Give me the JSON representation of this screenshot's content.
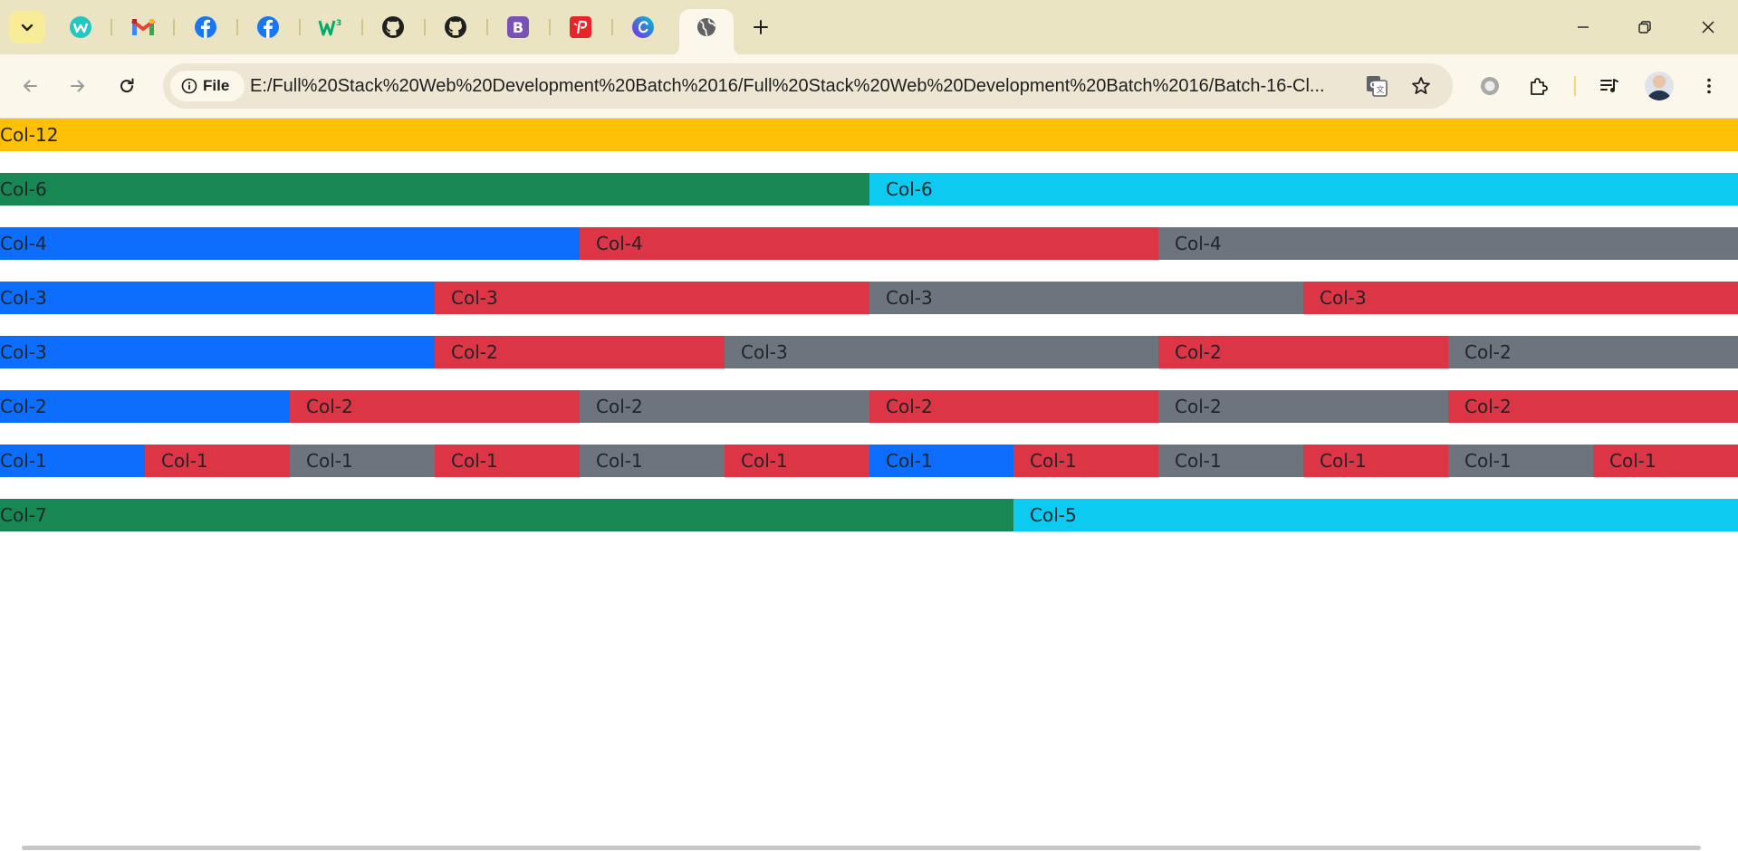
{
  "browser": {
    "tabs": [
      {
        "icon": "wix-icon"
      },
      {
        "icon": "gmail-icon"
      },
      {
        "icon": "facebook-icon"
      },
      {
        "icon": "facebook-icon"
      },
      {
        "icon": "w3schools-icon"
      },
      {
        "icon": "github-icon"
      },
      {
        "icon": "github-icon"
      },
      {
        "icon": "bootstrap-icon"
      },
      {
        "icon": "pdf-icon"
      },
      {
        "icon": "canva-icon"
      },
      {
        "icon": "globe-icon",
        "active": true
      }
    ],
    "site_chip_label": "File",
    "url": "E:/Full%20Stack%20Web%20Development%20Batch%2016/Full%20Stack%20Web%20Development%20Batch%2016/Batch-16-Cl...",
    "colors": {
      "tabstrip": "#ebe4c2",
      "toolbar": "#fbf7ea",
      "omnibox": "#ede6d3",
      "tab_search": "#f8ec98"
    }
  },
  "grid_rows": [
    [
      {
        "label": "Col-12",
        "span": 12,
        "color": "#ffc107"
      }
    ],
    [
      {
        "label": "Col-6",
        "span": 6,
        "color": "#198754"
      },
      {
        "label": "Col-6",
        "span": 6,
        "color": "#0dcaf0"
      }
    ],
    [
      {
        "label": "Col-4",
        "span": 4,
        "color": "#0d6efd"
      },
      {
        "label": "Col-4",
        "span": 4,
        "color": "#dc3545"
      },
      {
        "label": "Col-4",
        "span": 4,
        "color": "#6c757d"
      }
    ],
    [
      {
        "label": "Col-3",
        "span": 3,
        "color": "#0d6efd"
      },
      {
        "label": "Col-3",
        "span": 3,
        "color": "#dc3545"
      },
      {
        "label": "Col-3",
        "span": 3,
        "color": "#6c757d"
      },
      {
        "label": "Col-3",
        "span": 3,
        "color": "#dc3545"
      }
    ],
    [
      {
        "label": "Col-3",
        "span": 3,
        "color": "#0d6efd"
      },
      {
        "label": "Col-2",
        "span": 2,
        "color": "#dc3545"
      },
      {
        "label": "Col-3",
        "span": 3,
        "color": "#6c757d"
      },
      {
        "label": "Col-2",
        "span": 2,
        "color": "#dc3545"
      },
      {
        "label": "Col-2",
        "span": 2,
        "color": "#6c757d"
      }
    ],
    [
      {
        "label": "Col-2",
        "span": 2,
        "color": "#0d6efd"
      },
      {
        "label": "Col-2",
        "span": 2,
        "color": "#dc3545"
      },
      {
        "label": "Col-2",
        "span": 2,
        "color": "#6c757d"
      },
      {
        "label": "Col-2",
        "span": 2,
        "color": "#dc3545"
      },
      {
        "label": "Col-2",
        "span": 2,
        "color": "#6c757d"
      },
      {
        "label": "Col-2",
        "span": 2,
        "color": "#dc3545"
      }
    ],
    [
      {
        "label": "Col-1",
        "span": 1,
        "color": "#0d6efd"
      },
      {
        "label": "Col-1",
        "span": 1,
        "color": "#dc3545"
      },
      {
        "label": "Col-1",
        "span": 1,
        "color": "#6c757d"
      },
      {
        "label": "Col-1",
        "span": 1,
        "color": "#dc3545"
      },
      {
        "label": "Col-1",
        "span": 1,
        "color": "#6c757d"
      },
      {
        "label": "Col-1",
        "span": 1,
        "color": "#dc3545"
      },
      {
        "label": "Col-1",
        "span": 1,
        "color": "#0d6efd"
      },
      {
        "label": "Col-1",
        "span": 1,
        "color": "#dc3545"
      },
      {
        "label": "Col-1",
        "span": 1,
        "color": "#6c757d"
      },
      {
        "label": "Col-1",
        "span": 1,
        "color": "#dc3545"
      },
      {
        "label": "Col-1",
        "span": 1,
        "color": "#6c757d"
      },
      {
        "label": "Col-1",
        "span": 1,
        "color": "#dc3545"
      }
    ],
    [
      {
        "label": "Col-7",
        "span": 7,
        "color": "#198754"
      },
      {
        "label": "Col-5",
        "span": 5,
        "color": "#0dcaf0"
      }
    ]
  ]
}
